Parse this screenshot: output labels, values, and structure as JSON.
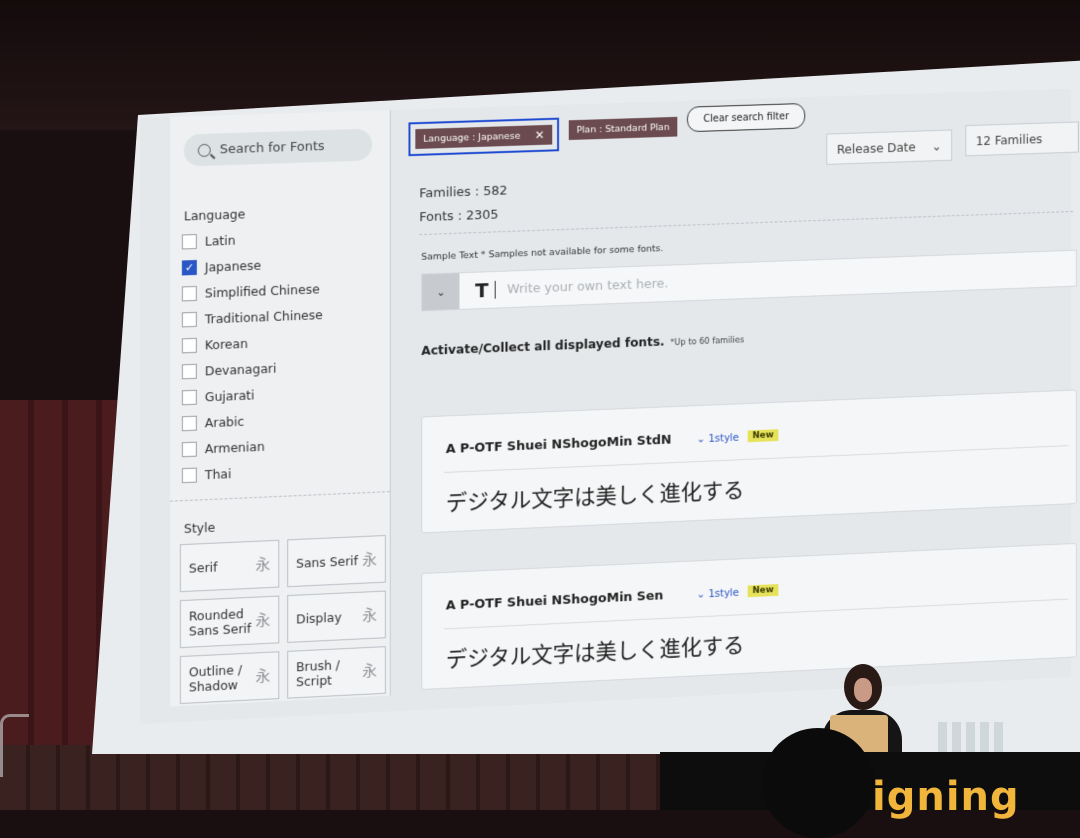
{
  "search": {
    "placeholder": "Search for Fonts"
  },
  "sidebar": {
    "language_title": "Language",
    "languages": [
      {
        "label": "Latin",
        "checked": false
      },
      {
        "label": "Japanese",
        "checked": true
      },
      {
        "label": "Simplified Chinese",
        "checked": false
      },
      {
        "label": "Traditional Chinese",
        "checked": false
      },
      {
        "label": "Korean",
        "checked": false
      },
      {
        "label": "Devanagari",
        "checked": false
      },
      {
        "label": "Gujarati",
        "checked": false
      },
      {
        "label": "Arabic",
        "checked": false
      },
      {
        "label": "Armenian",
        "checked": false
      },
      {
        "label": "Thai",
        "checked": false
      }
    ],
    "style_title": "Style",
    "styles": [
      {
        "label": "Serif",
        "glyph": "永"
      },
      {
        "label": "Sans Serif",
        "glyph": "永"
      },
      {
        "label": "Rounded Sans Serif",
        "glyph": "永"
      },
      {
        "label": "Display",
        "glyph": "永"
      },
      {
        "label": "Outline / Shadow",
        "glyph": "永"
      },
      {
        "label": "Brush / Script",
        "glyph": "永"
      }
    ]
  },
  "filters": {
    "language_chip": "Language : Japanese",
    "plan_chip": "Plan : Standard Plan",
    "clear_label": "Clear search filter"
  },
  "sort": {
    "selected": "Release Date"
  },
  "per_page": {
    "selected": "12 Families"
  },
  "stats": {
    "families": "Families : 582",
    "fonts": "Fonts : 2305"
  },
  "sample": {
    "label": "Sample Text * Samples not available for some fonts.",
    "placeholder": "Write your own text here."
  },
  "activate": {
    "label": "Activate/Collect all displayed fonts.",
    "note": "*Up to 60 families"
  },
  "fonts": [
    {
      "name": "A P-OTF Shuei NShogoMin StdN",
      "styles": "1style",
      "badge": "New",
      "sample": "デジタル文字は美しく進化する"
    },
    {
      "name": "A P-OTF Shuei NShogoMin Sen",
      "styles": "1style",
      "badge": "New",
      "sample": "デジタル文字は美しく進化する"
    }
  ],
  "venue": {
    "podium_text": "igning"
  }
}
